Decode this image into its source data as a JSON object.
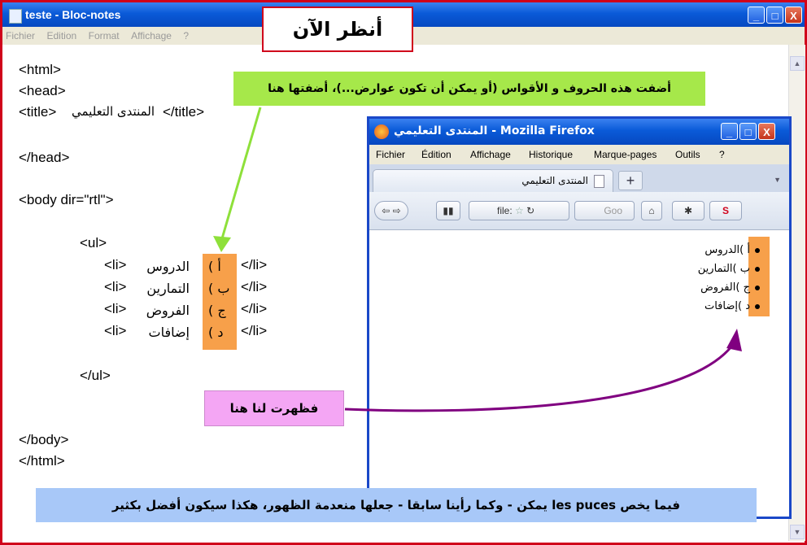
{
  "notepad": {
    "title": "teste - Bloc-notes",
    "menu": [
      "Fichier",
      "Edition",
      "Format",
      "Affichage",
      "?"
    ],
    "window_buttons": [
      "_",
      "□",
      "X"
    ],
    "code_lines": {
      "l1": "<html>",
      "l2": "<head>",
      "l3_open": "<title>",
      "l3_text": "المنتدى التعليمي",
      "l3_close": "</title>",
      "l4": "</head>",
      "l5": "<body dir=\"rtl\">",
      "l6": "<ul>",
      "l7": "</ul>",
      "l8": "</body>",
      "l9": "</html>"
    },
    "list_items": [
      {
        "open": "<li>",
        "letter": "أ )",
        "text": "الدروس",
        "close": "</li>"
      },
      {
        "open": "<li>",
        "letter": "ب )",
        "text": "التمارين",
        "close": "</li>"
      },
      {
        "open": "<li>",
        "letter": "ج )",
        "text": "الفروض",
        "close": "</li>"
      },
      {
        "open": "<li>",
        "letter": "د )",
        "text": "إضافات",
        "close": "</li>"
      }
    ]
  },
  "annotations": {
    "now": "أنظر الآن",
    "added": "أضفت هذه الحروف و الأقواس (أو يمكن أن تكون عوارض...)، أضفتها هنا",
    "appeared": "فظهرت لنا هنا",
    "bullets": "فيما يخص les puces يمكن - وكما رأينا سابقا - جعلها منعدمة الظهور، هكذا سيكون أفضل بكثير"
  },
  "firefox": {
    "title": "المنتدى التعليمي - Mozilla Firefox",
    "menu": [
      "Fichier",
      "Édition",
      "Affichage",
      "Historique",
      "Marque-pages",
      "Outils",
      "?"
    ],
    "tab_title": "المنتدى التعليمي",
    "new_tab": "+",
    "url": "file:",
    "search_placeholder": "Goo",
    "list": [
      {
        "letter": "أ )",
        "text": "الدروس"
      },
      {
        "letter": "ب )",
        "text": "التمارين"
      },
      {
        "letter": "ج )",
        "text": "الفروض"
      },
      {
        "letter": "د )",
        "text": "إضافات"
      }
    ]
  },
  "colors": {
    "frame_red": "#d0021b",
    "xp_blue": "#0a5ad8",
    "highlight_orange": "#f7a04a",
    "note_green": "#a6e84a",
    "note_pink": "#f4a6f4",
    "note_blue": "#a8c8f8",
    "arrow_green": "#8ee03a",
    "arrow_purple": "#800080"
  }
}
